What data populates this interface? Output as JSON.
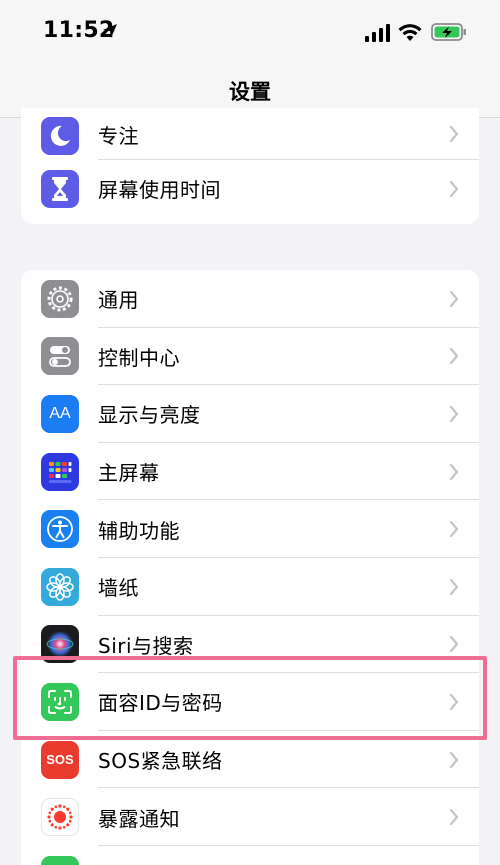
{
  "status_bar": {
    "time": "11:52"
  },
  "nav": {
    "title": "设置"
  },
  "group1": [
    {
      "label": "专注",
      "icon": "moon-icon",
      "color": "#5e5ce6"
    },
    {
      "label": "屏幕使用时间",
      "icon": "hourglass-icon",
      "color": "#5e5ce6"
    }
  ],
  "group2": [
    {
      "label": "通用",
      "icon": "gear-icon",
      "color": "#8e8e93"
    },
    {
      "label": "控制中心",
      "icon": "toggles-icon",
      "color": "#8e8e93"
    },
    {
      "label": "显示与亮度",
      "icon": "aa-text-icon",
      "icon_text": "AA",
      "color": "#1c7cf4"
    },
    {
      "label": "主屏幕",
      "icon": "home-grid-icon",
      "color": "#2d3ae0"
    },
    {
      "label": "辅助功能",
      "icon": "accessibility-icon",
      "color": "#1a80f0"
    },
    {
      "label": "墙纸",
      "icon": "flower-icon",
      "color": "#34aadc"
    },
    {
      "label": "Siri与搜索",
      "icon": "siri-icon",
      "color": "#1b1b1e"
    },
    {
      "label": "面容ID与密码",
      "icon": "face-id-icon",
      "color": "#34c759"
    },
    {
      "label": "SOS紧急联络",
      "icon": "sos-icon",
      "icon_text": "SOS",
      "color": "#ea3b2e"
    },
    {
      "label": "暴露通知",
      "icon": "exposure-icon",
      "color": "#ffffff"
    }
  ],
  "highlight_color": "#ee6f93"
}
